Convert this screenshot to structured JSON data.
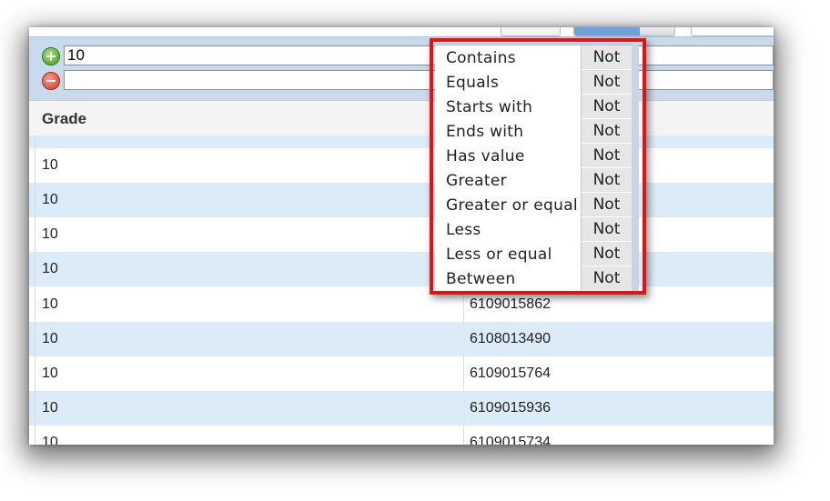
{
  "filter": {
    "value1": "10",
    "value2": ""
  },
  "grid": {
    "columns": [
      "Grade"
    ],
    "rows": [
      {
        "grade": "10",
        "id": ""
      },
      {
        "grade": "10",
        "id": ""
      },
      {
        "grade": "10",
        "id": ""
      },
      {
        "grade": "10",
        "id": ""
      },
      {
        "grade": "10",
        "id": ""
      },
      {
        "grade": "10",
        "id": "6109015862"
      },
      {
        "grade": "10",
        "id": "6108013490"
      },
      {
        "grade": "10",
        "id": "6109015764"
      },
      {
        "grade": "10",
        "id": "6109015936"
      },
      {
        "grade": "10",
        "id": "6109015734"
      }
    ]
  },
  "menu": {
    "not_label": "Not",
    "items": [
      "Contains",
      "Equals",
      "Starts with",
      "Ends with",
      "Has value",
      "Greater",
      "Greater or equal",
      "Less",
      "Less or equal",
      "Between"
    ]
  },
  "colors": {
    "highlight_border": "#e01414",
    "alt_row": "#dcebf8",
    "filter_panel": "#c7dbed"
  },
  "icons": {
    "add_filter": "plus-icon",
    "remove_filter": "minus-icon"
  }
}
